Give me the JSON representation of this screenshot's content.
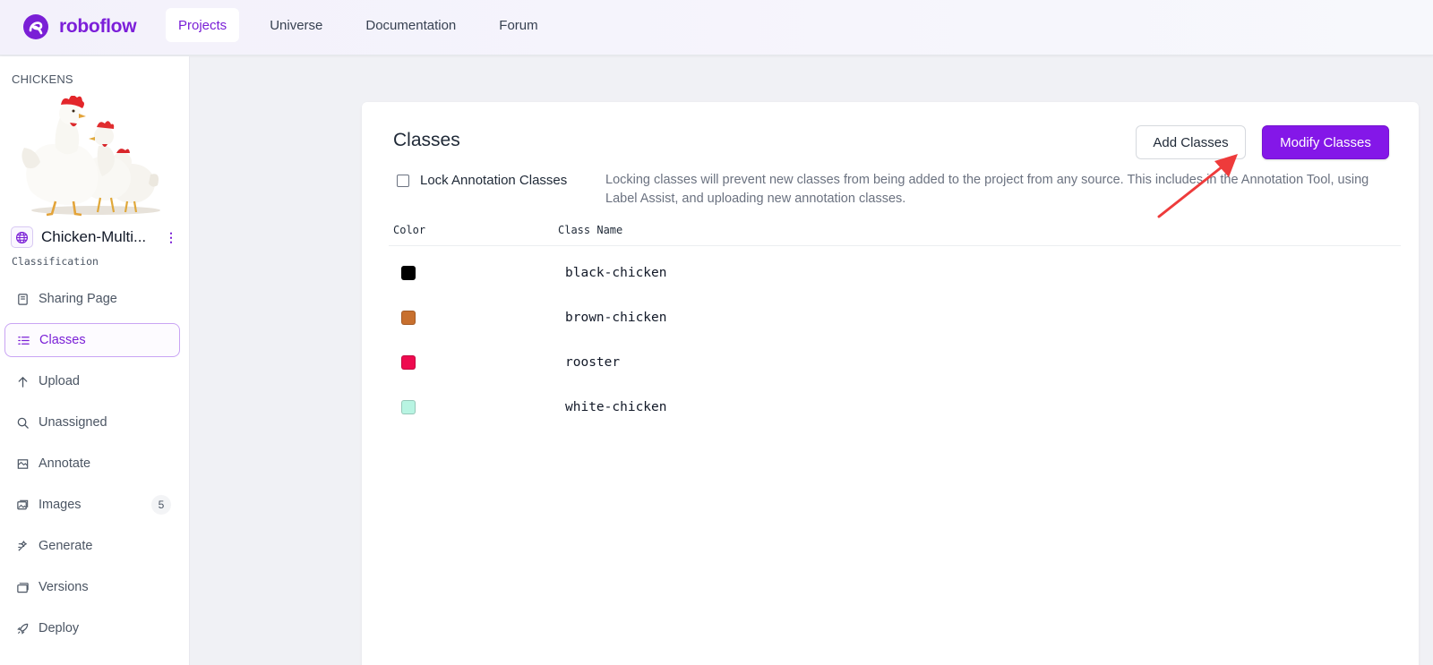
{
  "brand": {
    "name": "roboflow",
    "accent": "#7a1fd6"
  },
  "topnav": [
    {
      "label": "Projects",
      "active": true
    },
    {
      "label": "Universe",
      "active": false
    },
    {
      "label": "Documentation",
      "active": false
    },
    {
      "label": "Forum",
      "active": false
    }
  ],
  "project": {
    "caption": "CHICKENS",
    "name": "Chicken-Multi...",
    "type": "Classification",
    "visibility_icon": "globe-icon"
  },
  "sidebar": {
    "items": [
      {
        "label": "Sharing Page",
        "icon": "book-icon"
      },
      {
        "label": "Classes",
        "icon": "list-icon",
        "active": true
      },
      {
        "label": "Upload",
        "icon": "upload-arrow-icon"
      },
      {
        "label": "Unassigned",
        "icon": "search-icon"
      },
      {
        "label": "Annotate",
        "icon": "annotate-icon"
      },
      {
        "label": "Images",
        "icon": "images-icon",
        "count": "5"
      },
      {
        "label": "Generate",
        "icon": "generate-icon"
      },
      {
        "label": "Versions",
        "icon": "versions-icon"
      },
      {
        "label": "Deploy",
        "icon": "rocket-icon"
      }
    ]
  },
  "classes_panel": {
    "title": "Classes",
    "add_button": "Add Classes",
    "modify_button": "Modify Classes",
    "lock_label": "Lock Annotation Classes",
    "lock_checked": false,
    "lock_description": "Locking classes will prevent new classes from being added to the project from any source. This includes in the Annotation Tool, using Label Assist, and uploading new annotation classes.",
    "columns": [
      "Color",
      "Class Name"
    ],
    "rows": [
      {
        "color": "#000000",
        "name": "black-chicken"
      },
      {
        "color": "#c8702e",
        "name": "brown-chicken"
      },
      {
        "color": "#ee0a4f",
        "name": "rooster"
      },
      {
        "color": "#b8f4e2",
        "name": "white-chicken"
      }
    ]
  },
  "annotation_arrow_color": "#ee3b3b"
}
